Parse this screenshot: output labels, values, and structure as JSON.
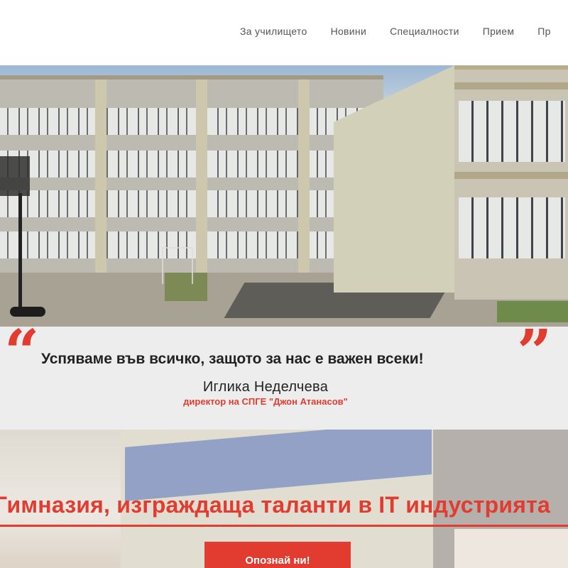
{
  "nav": {
    "items": [
      {
        "label": "За училището"
      },
      {
        "label": "Новини"
      },
      {
        "label": "Специалности"
      },
      {
        "label": "Прием"
      },
      {
        "label": "Пр"
      }
    ]
  },
  "quote": {
    "text": "Успяваме във всичко, защото за нас е важен всеки!",
    "author": "Иглика Неделчева",
    "role": "директор на СПГЕ \"Джон Атанасов\"",
    "open_mark": "“",
    "close_mark": "”"
  },
  "banner": {
    "slogan": "Гимназия, изграждаща таланти в IT индустрията",
    "button_label": "Опознай ни!"
  },
  "colors": {
    "accent": "#e23b2f",
    "quote_bg": "#ededed",
    "nav_text": "#555555"
  }
}
